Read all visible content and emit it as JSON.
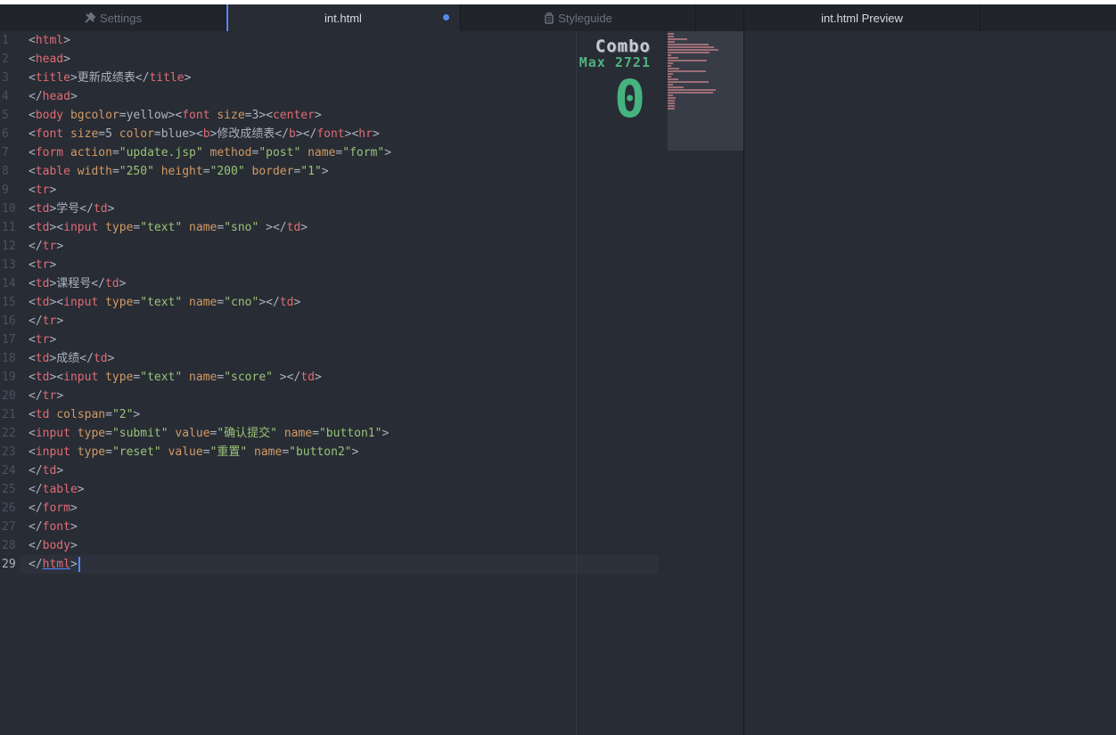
{
  "tabs": [
    {
      "label": "Settings",
      "icon": "tools-icon"
    },
    {
      "label": "int.html",
      "modified": true
    },
    {
      "label": "Styleguide",
      "icon": "paint-bucket-icon"
    },
    {
      "label": ""
    },
    {
      "label": "int.html Preview"
    }
  ],
  "editor": {
    "line_numbers": [
      "1",
      "2",
      "3",
      "4",
      "5",
      "6",
      "7",
      "8",
      "9",
      "10",
      "11",
      "12",
      "13",
      "14",
      "15",
      "16",
      "17",
      "18",
      "19",
      "20",
      "21",
      "22",
      "23",
      "24",
      "25",
      "26",
      "27",
      "28",
      "29"
    ],
    "current_line": 29,
    "lines": [
      [
        [
          "<",
          "p"
        ],
        [
          "html",
          "t"
        ],
        [
          ">",
          "p"
        ]
      ],
      [
        [
          "<",
          "p"
        ],
        [
          "head",
          "t"
        ],
        [
          ">",
          "p"
        ]
      ],
      [
        [
          "<",
          "p"
        ],
        [
          "title",
          "t"
        ],
        [
          ">更新成绩表</",
          "p"
        ],
        [
          "title",
          "t"
        ],
        [
          ">",
          "p"
        ]
      ],
      [
        [
          "</",
          "p"
        ],
        [
          "head",
          "t"
        ],
        [
          ">",
          "p"
        ]
      ],
      [
        [
          "<",
          "p"
        ],
        [
          "body",
          "t"
        ],
        [
          " ",
          "p"
        ],
        [
          "bgcolor",
          "a"
        ],
        [
          "=yellow><",
          "p"
        ],
        [
          "font",
          "t"
        ],
        [
          " ",
          "p"
        ],
        [
          "size",
          "a"
        ],
        [
          "=3><",
          "p"
        ],
        [
          "center",
          "t"
        ],
        [
          ">",
          "p"
        ]
      ],
      [
        [
          "<",
          "p"
        ],
        [
          "font",
          "t"
        ],
        [
          " ",
          "p"
        ],
        [
          "size",
          "a"
        ],
        [
          "=5 ",
          "p"
        ],
        [
          "color",
          "a"
        ],
        [
          "=blue><",
          "p"
        ],
        [
          "b",
          "t"
        ],
        [
          ">修改成绩表</",
          "p"
        ],
        [
          "b",
          "t"
        ],
        [
          "></",
          "p"
        ],
        [
          "font",
          "t"
        ],
        [
          "><",
          "p"
        ],
        [
          "hr",
          "t"
        ],
        [
          ">",
          "p"
        ]
      ],
      [
        [
          "<",
          "p"
        ],
        [
          "form",
          "t"
        ],
        [
          " ",
          "p"
        ],
        [
          "action",
          "a"
        ],
        [
          "=",
          "p"
        ],
        [
          "\"update.jsp\"",
          "s"
        ],
        [
          " ",
          "p"
        ],
        [
          "method",
          "a"
        ],
        [
          "=",
          "p"
        ],
        [
          "\"post\"",
          "s"
        ],
        [
          " ",
          "p"
        ],
        [
          "name",
          "a"
        ],
        [
          "=",
          "p"
        ],
        [
          "\"form\"",
          "s"
        ],
        [
          ">",
          "p"
        ]
      ],
      [
        [
          "<",
          "p"
        ],
        [
          "table",
          "t"
        ],
        [
          " ",
          "p"
        ],
        [
          "width",
          "a"
        ],
        [
          "=",
          "p"
        ],
        [
          "\"250\"",
          "s"
        ],
        [
          " ",
          "p"
        ],
        [
          "height",
          "a"
        ],
        [
          "=",
          "p"
        ],
        [
          "\"200\"",
          "s"
        ],
        [
          " ",
          "p"
        ],
        [
          "border",
          "a"
        ],
        [
          "=",
          "p"
        ],
        [
          "\"1\"",
          "s"
        ],
        [
          ">",
          "p"
        ]
      ],
      [
        [
          "<",
          "p"
        ],
        [
          "tr",
          "t"
        ],
        [
          ">",
          "p"
        ]
      ],
      [
        [
          "<",
          "p"
        ],
        [
          "td",
          "t"
        ],
        [
          ">学号</",
          "p"
        ],
        [
          "td",
          "t"
        ],
        [
          ">",
          "p"
        ]
      ],
      [
        [
          "<",
          "p"
        ],
        [
          "td",
          "t"
        ],
        [
          "><",
          "p"
        ],
        [
          "input",
          "t"
        ],
        [
          " ",
          "p"
        ],
        [
          "type",
          "a"
        ],
        [
          "=",
          "p"
        ],
        [
          "\"text\"",
          "s"
        ],
        [
          " ",
          "p"
        ],
        [
          "name",
          "a"
        ],
        [
          "=",
          "p"
        ],
        [
          "\"sno\"",
          "s"
        ],
        [
          " ></",
          "p"
        ],
        [
          "td",
          "t"
        ],
        [
          ">",
          "p"
        ]
      ],
      [
        [
          "</",
          "p"
        ],
        [
          "tr",
          "t"
        ],
        [
          ">",
          "p"
        ]
      ],
      [
        [
          "<",
          "p"
        ],
        [
          "tr",
          "t"
        ],
        [
          ">",
          "p"
        ]
      ],
      [
        [
          "<",
          "p"
        ],
        [
          "td",
          "t"
        ],
        [
          ">课程号</",
          "p"
        ],
        [
          "td",
          "t"
        ],
        [
          ">",
          "p"
        ]
      ],
      [
        [
          "<",
          "p"
        ],
        [
          "td",
          "t"
        ],
        [
          "><",
          "p"
        ],
        [
          "input",
          "t"
        ],
        [
          " ",
          "p"
        ],
        [
          "type",
          "a"
        ],
        [
          "=",
          "p"
        ],
        [
          "\"text\"",
          "s"
        ],
        [
          " ",
          "p"
        ],
        [
          "name",
          "a"
        ],
        [
          "=",
          "p"
        ],
        [
          "\"cno\"",
          "s"
        ],
        [
          "></",
          "p"
        ],
        [
          "td",
          "t"
        ],
        [
          ">",
          "p"
        ]
      ],
      [
        [
          "</",
          "p"
        ],
        [
          "tr",
          "t"
        ],
        [
          ">",
          "p"
        ]
      ],
      [
        [
          "<",
          "p"
        ],
        [
          "tr",
          "t"
        ],
        [
          ">",
          "p"
        ]
      ],
      [
        [
          "<",
          "p"
        ],
        [
          "td",
          "t"
        ],
        [
          ">成绩</",
          "p"
        ],
        [
          "td",
          "t"
        ],
        [
          ">",
          "p"
        ]
      ],
      [
        [
          "<",
          "p"
        ],
        [
          "td",
          "t"
        ],
        [
          "><",
          "p"
        ],
        [
          "input",
          "t"
        ],
        [
          " ",
          "p"
        ],
        [
          "type",
          "a"
        ],
        [
          "=",
          "p"
        ],
        [
          "\"text\"",
          "s"
        ],
        [
          " ",
          "p"
        ],
        [
          "name",
          "a"
        ],
        [
          "=",
          "p"
        ],
        [
          "\"score\"",
          "s"
        ],
        [
          " ></",
          "p"
        ],
        [
          "td",
          "t"
        ],
        [
          ">",
          "p"
        ]
      ],
      [
        [
          "</",
          "p"
        ],
        [
          "tr",
          "t"
        ],
        [
          ">",
          "p"
        ]
      ],
      [
        [
          "<",
          "p"
        ],
        [
          "td",
          "t"
        ],
        [
          " ",
          "p"
        ],
        [
          "colspan",
          "a"
        ],
        [
          "=",
          "p"
        ],
        [
          "\"2\"",
          "s"
        ],
        [
          ">",
          "p"
        ]
      ],
      [
        [
          "<",
          "p"
        ],
        [
          "input",
          "t"
        ],
        [
          " ",
          "p"
        ],
        [
          "type",
          "a"
        ],
        [
          "=",
          "p"
        ],
        [
          "\"submit\"",
          "s"
        ],
        [
          " ",
          "p"
        ],
        [
          "value",
          "a"
        ],
        [
          "=",
          "p"
        ],
        [
          "\"确认提交\"",
          "s"
        ],
        [
          " ",
          "p"
        ],
        [
          "name",
          "a"
        ],
        [
          "=",
          "p"
        ],
        [
          "\"button1\"",
          "s"
        ],
        [
          ">",
          "p"
        ]
      ],
      [
        [
          "<",
          "p"
        ],
        [
          "input",
          "t"
        ],
        [
          " ",
          "p"
        ],
        [
          "type",
          "a"
        ],
        [
          "=",
          "p"
        ],
        [
          "\"reset\"",
          "s"
        ],
        [
          " ",
          "p"
        ],
        [
          "value",
          "a"
        ],
        [
          "=",
          "p"
        ],
        [
          "\"重置\"",
          "s"
        ],
        [
          " ",
          "p"
        ],
        [
          "name",
          "a"
        ],
        [
          "=",
          "p"
        ],
        [
          "\"button2\"",
          "s"
        ],
        [
          ">",
          "p"
        ]
      ],
      [
        [
          "</",
          "p"
        ],
        [
          "td",
          "t"
        ],
        [
          ">",
          "p"
        ]
      ],
      [
        [
          "</",
          "p"
        ],
        [
          "table",
          "t"
        ],
        [
          ">",
          "p"
        ]
      ],
      [
        [
          "</",
          "p"
        ],
        [
          "form",
          "t"
        ],
        [
          ">",
          "p"
        ]
      ],
      [
        [
          "</",
          "p"
        ],
        [
          "font",
          "t"
        ],
        [
          ">",
          "p"
        ]
      ],
      [
        [
          "</",
          "p"
        ],
        [
          "body",
          "t"
        ],
        [
          ">",
          "p"
        ]
      ],
      [
        [
          "</",
          "p"
        ],
        [
          "html",
          "t"
        ],
        [
          ">",
          "p"
        ]
      ]
    ]
  },
  "combo": {
    "title": "Combo",
    "max_label": "Max 2721",
    "count": "0"
  },
  "colors": {
    "tag": "#e06c75",
    "attribute": "#d19a66",
    "string": "#98c379",
    "accent": "#568af2",
    "combo": "#45b37f"
  }
}
